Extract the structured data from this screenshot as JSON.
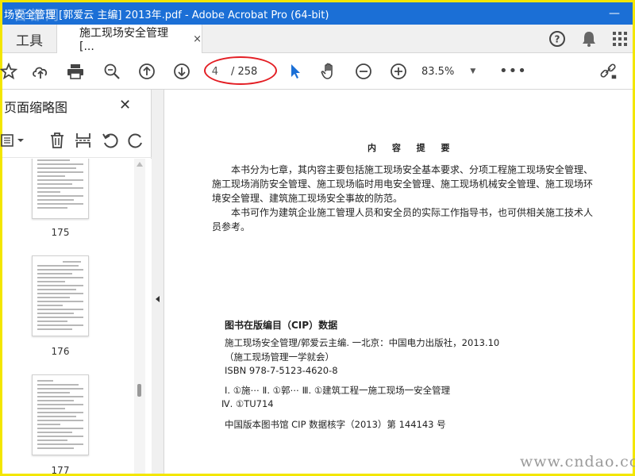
{
  "window": {
    "title": "场安全管理 [郭爱云 主编] 2013年.pdf - Adobe Acrobat Pro (64-bit)",
    "watermark": "百都网",
    "minimize": "—"
  },
  "tabs": {
    "tools_label": "工具",
    "doc_label": "施工现场安全管理 [...",
    "close_glyph": "×"
  },
  "toolbar": {
    "current_page": "4",
    "page_total": "/ 258",
    "zoom_value": "83.5%",
    "more_glyph": "•••"
  },
  "sidebar": {
    "title": "页面缩略图",
    "close_glyph": "✕",
    "thumbnails": [
      {
        "page": "175"
      },
      {
        "page": "176"
      },
      {
        "page": "177"
      }
    ]
  },
  "document": {
    "heading": "内 容 提 要",
    "para1": "本书分为七章，其内容主要包括施工现场安全基本要求、分项工程施工现场安全管理、施工现场消防安全管理、施工现场临时用电安全管理、施工现场机械安全管理、施工现场环境安全管理、建筑施工现场安全事故的防范。",
    "para2": "本书可作为建筑企业施工管理人员和安全员的实际工作指导书，也可供相关施工技术人员参考。",
    "cip_heading": "图书在版编目（CIP）数据",
    "cip_lines": [
      "施工现场安全管理/郭爱云主编. 一北京：中国电力出版社，2013.10",
      "（施工现场管理一学就会）",
      "ISBN 978-7-5123-4620-8",
      "Ⅰ. ①施⋯   Ⅱ. ①郭⋯   Ⅲ. ①建筑工程一施工现场一安全管理",
      "Ⅳ. ①TU714",
      "中国版本图书馆 CIP 数据核字（2013）第 144143 号"
    ]
  },
  "footer_watermark": "www.cndao.com",
  "colors": {
    "titlebar": "#1b6fd6",
    "highlight_ring": "#e31e24",
    "select_tool": "#1b6fd6",
    "frame": "#f3e600"
  }
}
